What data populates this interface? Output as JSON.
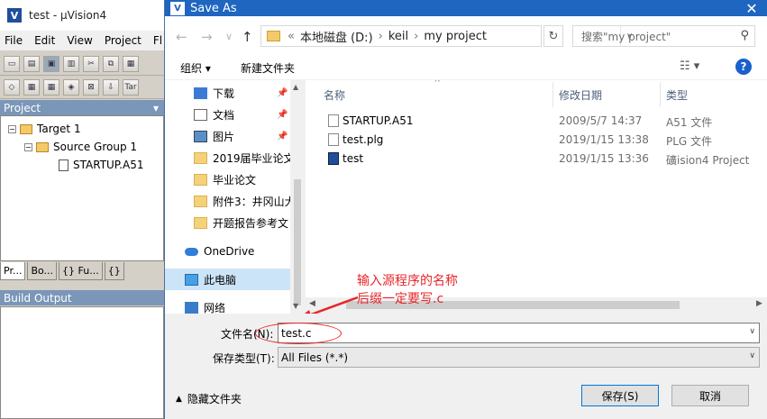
{
  "uvision": {
    "title": "test - μVision4",
    "menu": [
      "File",
      "Edit",
      "View",
      "Project",
      "Fl"
    ],
    "project_panel_title": "Project",
    "tree": {
      "target": "Target 1",
      "group": "Source Group 1",
      "file": "STARTUP.A51"
    },
    "tabs": [
      "Pr...",
      "Bo...",
      "{} Fu...",
      "{}"
    ],
    "build_output_title": "Build Output",
    "toolbar_text": "Tar"
  },
  "dialog": {
    "title": "Save As",
    "address": {
      "prefix": "«",
      "segments": [
        "本地磁盘 (D:)",
        "keil",
        "my project"
      ]
    },
    "search_placeholder": "搜索\"my project\"",
    "organize_label": "组织 ▾",
    "new_folder_label": "新建文件夹",
    "nav_items": [
      {
        "label": "下载",
        "icon": "download-icon",
        "pinned": true
      },
      {
        "label": "文档",
        "icon": "documents-icon",
        "pinned": true
      },
      {
        "label": "图片",
        "icon": "pictures-icon",
        "pinned": true
      },
      {
        "label": "2019届毕业论文",
        "icon": "folder-icon",
        "pinned": false
      },
      {
        "label": "毕业论文",
        "icon": "folder-icon",
        "pinned": false
      },
      {
        "label": "附件3：井冈山大",
        "icon": "folder-icon",
        "pinned": false
      },
      {
        "label": "开题报告参考文",
        "icon": "folder-icon",
        "pinned": false
      },
      {
        "label": "OneDrive",
        "icon": "cloud-icon",
        "pinned": false
      },
      {
        "label": "此电脑",
        "icon": "computer-icon",
        "pinned": false
      },
      {
        "label": "网络",
        "icon": "network-icon",
        "pinned": false
      }
    ],
    "columns": {
      "name": "名称",
      "date": "修改日期",
      "type": "类型"
    },
    "files": [
      {
        "name": "STARTUP.A51",
        "date": "2009/5/7 14:37",
        "type": "A51 文件"
      },
      {
        "name": "test.plg",
        "date": "2019/1/15 13:38",
        "type": "PLG 文件"
      },
      {
        "name": "test",
        "date": "2019/1/15 13:36",
        "type": "礦ision4 Project"
      }
    ],
    "filename_label": "文件名(N):",
    "filename_value": "test.c",
    "filetype_label": "保存类型(T):",
    "filetype_value": "All Files (*.*)",
    "hide_folders_label": "隐藏文件夹",
    "save_label": "保存(S)",
    "cancel_label": "取消"
  },
  "annotation": {
    "line1": "输入源程序的名称",
    "line2": "后缀一定要写.c",
    "color": "#e8262a"
  }
}
